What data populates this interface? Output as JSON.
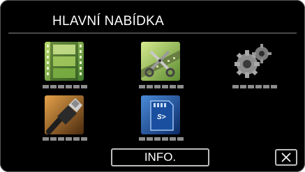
{
  "menu": {
    "title": "HLAVNÍ NABÍDKA",
    "items": [
      {
        "icon": "film-strip-icon",
        "label": "▪▪▪▪▪▪"
      },
      {
        "icon": "video-edit-scissors-icon",
        "label": "▪▪▪▪▪▪"
      },
      {
        "icon": "settings-gears-icon",
        "label": "▪▪▪▪▪▪"
      },
      {
        "icon": "hdmi-cable-icon",
        "label": "▪▪▪▪▪▪"
      },
      {
        "icon": "sd-card-icon",
        "label": "▪▪▪▪▪▪"
      }
    ]
  },
  "footer": {
    "info_label": "INFO.",
    "close_icon": "close-icon"
  },
  "colors": {
    "background": "#000000",
    "text": "#ffffff",
    "button_border": "#bdbdbd",
    "placeholder_caption": "#8c8c8c"
  }
}
